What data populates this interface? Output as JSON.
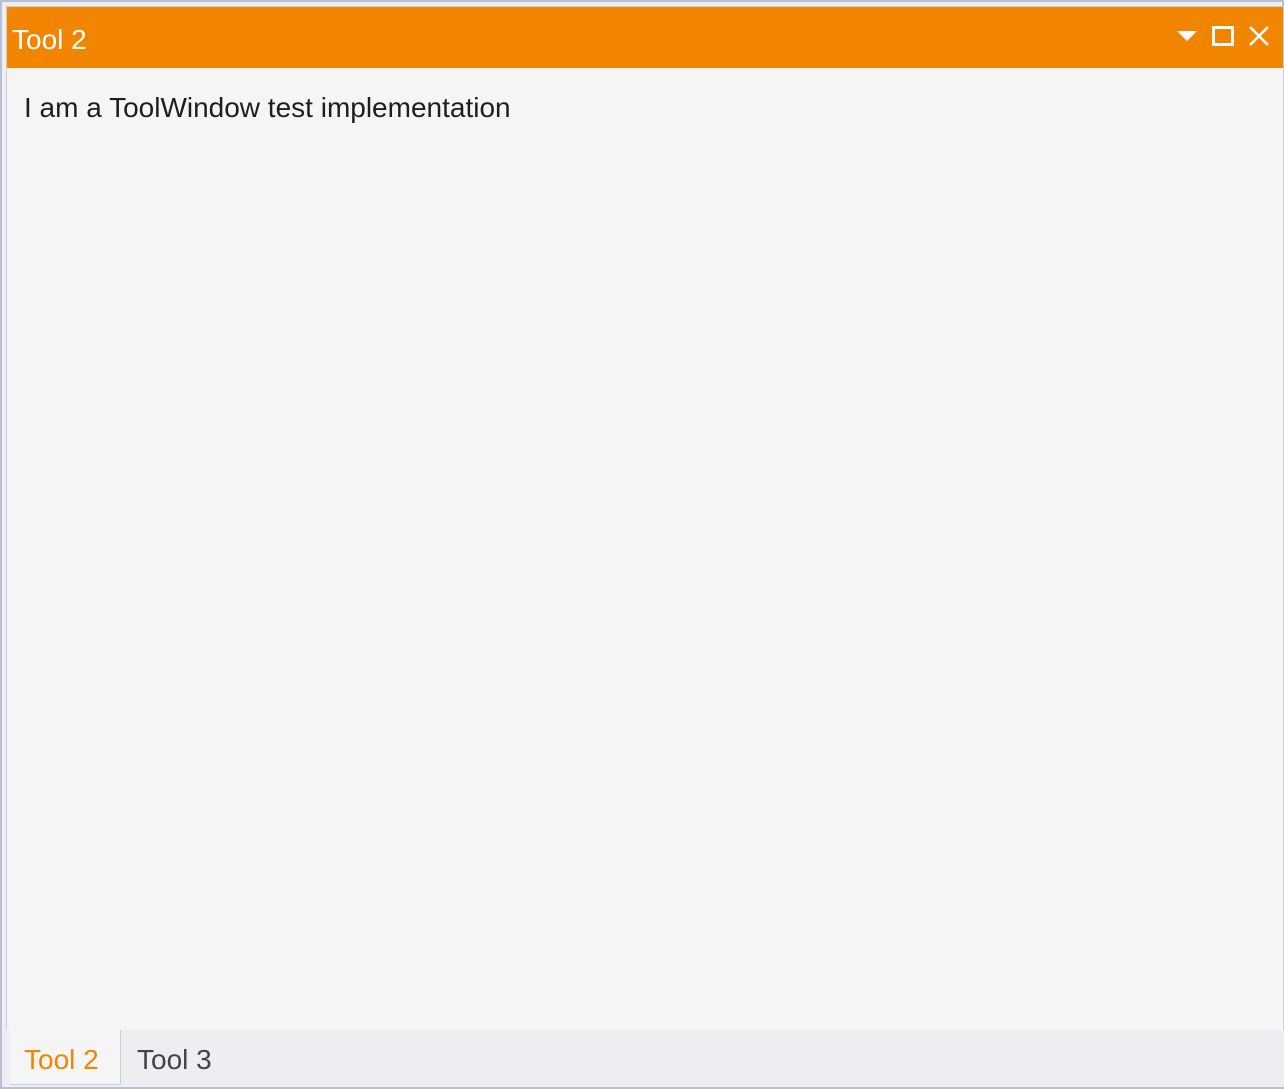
{
  "window": {
    "title": "Tool 2",
    "content_text": "I am a ToolWindow test implementation",
    "buttons": [
      {
        "icon": "dropdown-arrow-icon"
      },
      {
        "icon": "maximize-icon"
      },
      {
        "icon": "close-icon"
      }
    ]
  },
  "tabs": [
    {
      "label": "Tool 2",
      "active": true
    },
    {
      "label": "Tool 3",
      "active": false
    }
  ],
  "colors": {
    "accent": "#f28500",
    "panel_background": "#f5f5f5",
    "frame_background": "#eeeef2",
    "border": "#cccedb"
  }
}
